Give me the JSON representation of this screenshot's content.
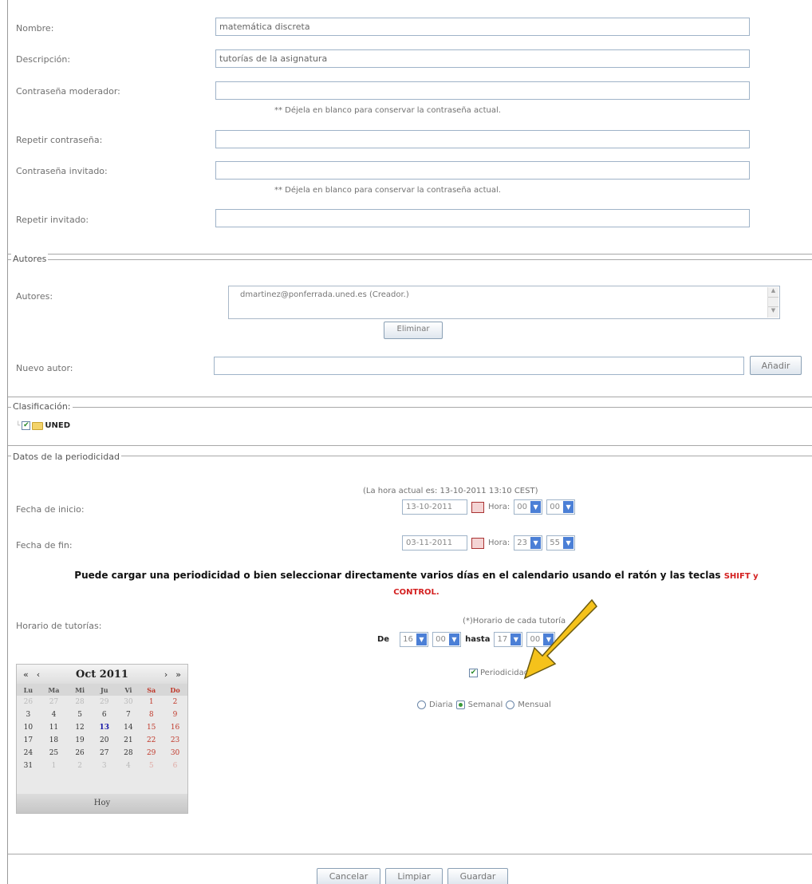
{
  "fields": {
    "nombre": {
      "label": "Nombre:",
      "value": "matemática discreta"
    },
    "descripcion": {
      "label": "Descripción:",
      "value": "tutorías de la asignatura"
    },
    "contrasena_moderador": {
      "label": "Contraseña moderador:",
      "value": ""
    },
    "moderador_note": "** Déjela en blanco para conservar la contraseña actual.",
    "repetir_contrasena": {
      "label": "Repetir contraseña:",
      "value": ""
    },
    "contrasena_invitado": {
      "label": "Contraseña invitado:",
      "value": ""
    },
    "invitado_note": "** Déjela en blanco para conservar la contraseña actual.",
    "repetir_invitado": {
      "label": "Repetir invitado:",
      "value": ""
    }
  },
  "autores": {
    "legend": "Autores",
    "label": "Autores:",
    "list_value": "dmartinez@ponferrada.uned.es (Creador.)",
    "eliminar_label": "Eliminar",
    "nuevo_label": "Nuevo autor:",
    "nuevo_value": "",
    "anadir_label": "Añadir"
  },
  "clasificacion": {
    "legend": "Clasificación:",
    "tree_item": "UNED"
  },
  "periodicidad": {
    "legend": "Datos de la periodicidad",
    "hora_actual": "(La hora actual es: 13-10-2011 13:10 CEST)",
    "inicio": {
      "label": "Fecha de inicio:",
      "date": "13-10-2011",
      "hora_label": "Hora:",
      "h": "00",
      "m": "00"
    },
    "fin": {
      "label": "Fecha de fin:",
      "date": "03-11-2011",
      "hora_label": "Hora:",
      "h": "23",
      "m": "55"
    },
    "instruction_main": "Puede cargar una periodicidad o bien seleccionar directamente varios días en el calendario usando el ratón y las teclas ",
    "instruction_keys_1": "SHIFT y",
    "instruction_keys_2": "CONTROL.",
    "horario_label": "Horario de tutorías:",
    "horario_cada": "(*)Horario de cada tutoría",
    "de_label": "De",
    "de_h": "16",
    "de_m": "00",
    "hasta_label": "hasta",
    "hasta_h": "17",
    "hasta_m": "00",
    "periodicidad_label": "Periodicidad",
    "diaria_label": "Diaria",
    "semanal_label": "Semanal",
    "mensual_label": "Mensual",
    "selected": "Semanal"
  },
  "calendar": {
    "title": "Oct 2011",
    "prev_year": "«",
    "prev_month": "‹",
    "next_month": "›",
    "next_year": "»",
    "days": [
      "Lu",
      "Ma",
      "Mi",
      "Ju",
      "Vi",
      "Sa",
      "Do"
    ],
    "weeks": [
      [
        "26",
        "27",
        "28",
        "29",
        "30",
        "1",
        "2"
      ],
      [
        "3",
        "4",
        "5",
        "6",
        "7",
        "8",
        "9"
      ],
      [
        "10",
        "11",
        "12",
        "13",
        "14",
        "15",
        "16"
      ],
      [
        "17",
        "18",
        "19",
        "20",
        "21",
        "22",
        "23"
      ],
      [
        "24",
        "25",
        "26",
        "27",
        "28",
        "29",
        "30"
      ],
      [
        "31",
        "1",
        "2",
        "3",
        "4",
        "5",
        "6"
      ]
    ],
    "today": "13",
    "hoy_label": "Hoy"
  },
  "buttons": {
    "cancelar": "Cancelar",
    "limpiar": "Limpiar",
    "guardar": "Guardar"
  },
  "colors": {
    "arrow": "#f5c21b",
    "keys_highlight": "#d42020"
  }
}
